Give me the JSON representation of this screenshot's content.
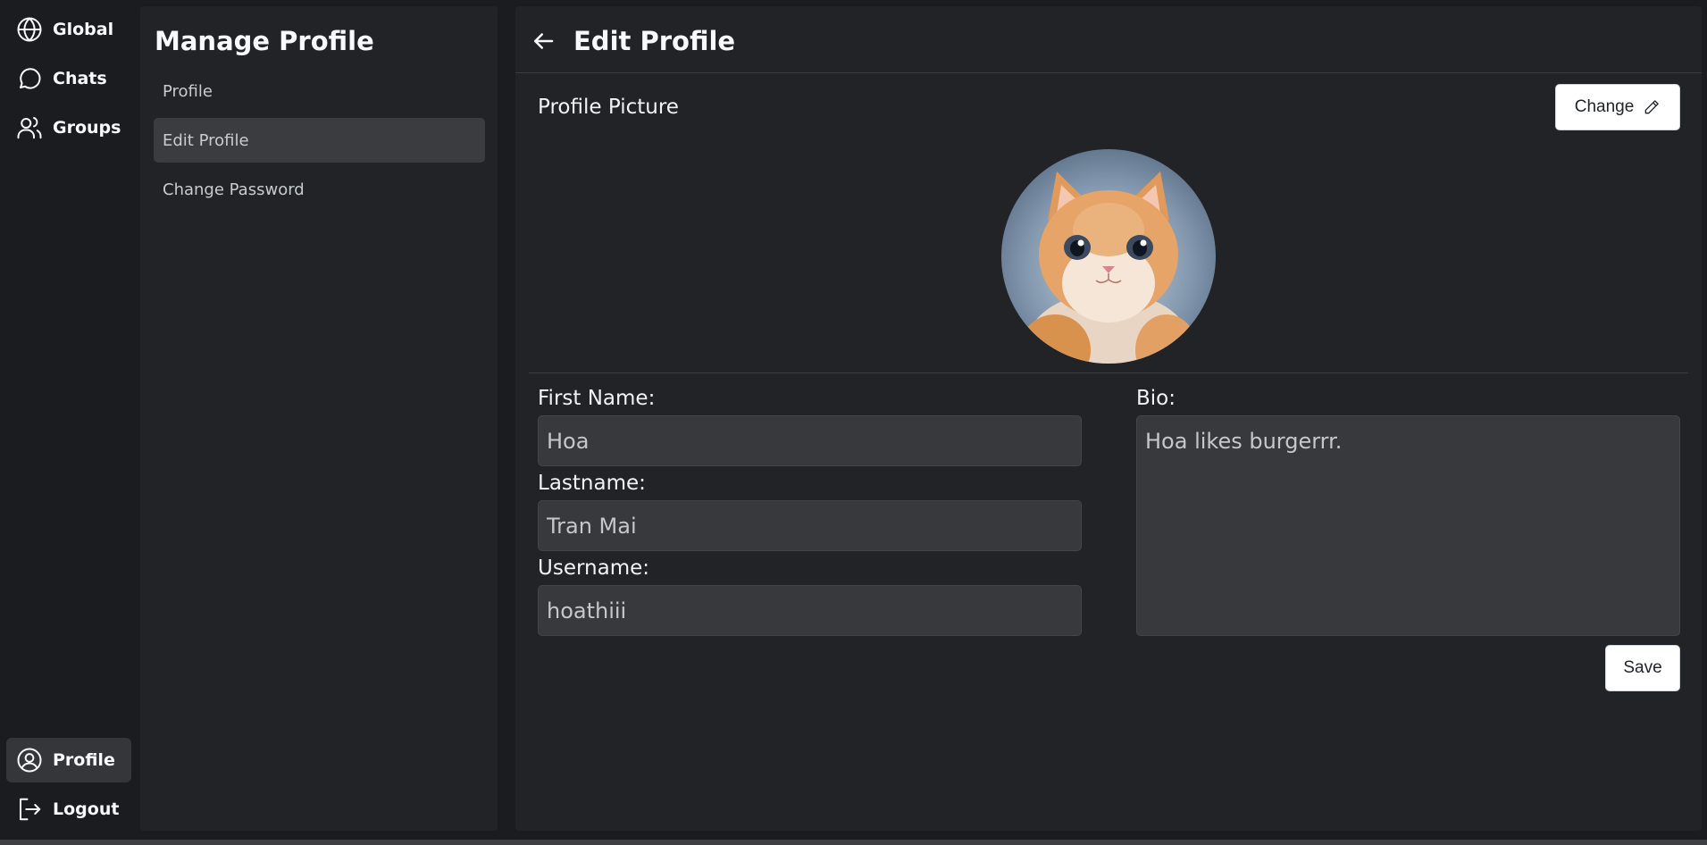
{
  "nav": {
    "items": [
      {
        "label": "Global",
        "icon": "globe-icon"
      },
      {
        "label": "Chats",
        "icon": "chat-bubble-icon"
      },
      {
        "label": "Groups",
        "icon": "users-icon"
      }
    ],
    "bottom": [
      {
        "label": "Profile",
        "icon": "user-circle-icon",
        "active": true
      },
      {
        "label": "Logout",
        "icon": "logout-icon"
      }
    ]
  },
  "panel": {
    "title": "Manage Profile",
    "items": [
      {
        "label": "Profile"
      },
      {
        "label": "Edit Profile",
        "active": true
      },
      {
        "label": "Change Password"
      }
    ]
  },
  "main": {
    "title": "Edit Profile",
    "picture_label": "Profile Picture",
    "change_label": "Change",
    "avatar_alt": "orange kitten avatar",
    "form": {
      "first_name_label": "First Name:",
      "first_name_value": "Hoa",
      "last_name_label": "Lastname:",
      "last_name_value": "Tran Mai",
      "username_label": "Username:",
      "username_value": "hoathiii",
      "bio_label": "Bio:",
      "bio_value": "Hoa likes burgerrr."
    },
    "save_label": "Save"
  },
  "colors": {
    "background": "#1b1c1f",
    "panel": "#212327",
    "active_item": "#3a3c40",
    "input_bg": "#38393d",
    "button_bg": "#ffffff"
  }
}
